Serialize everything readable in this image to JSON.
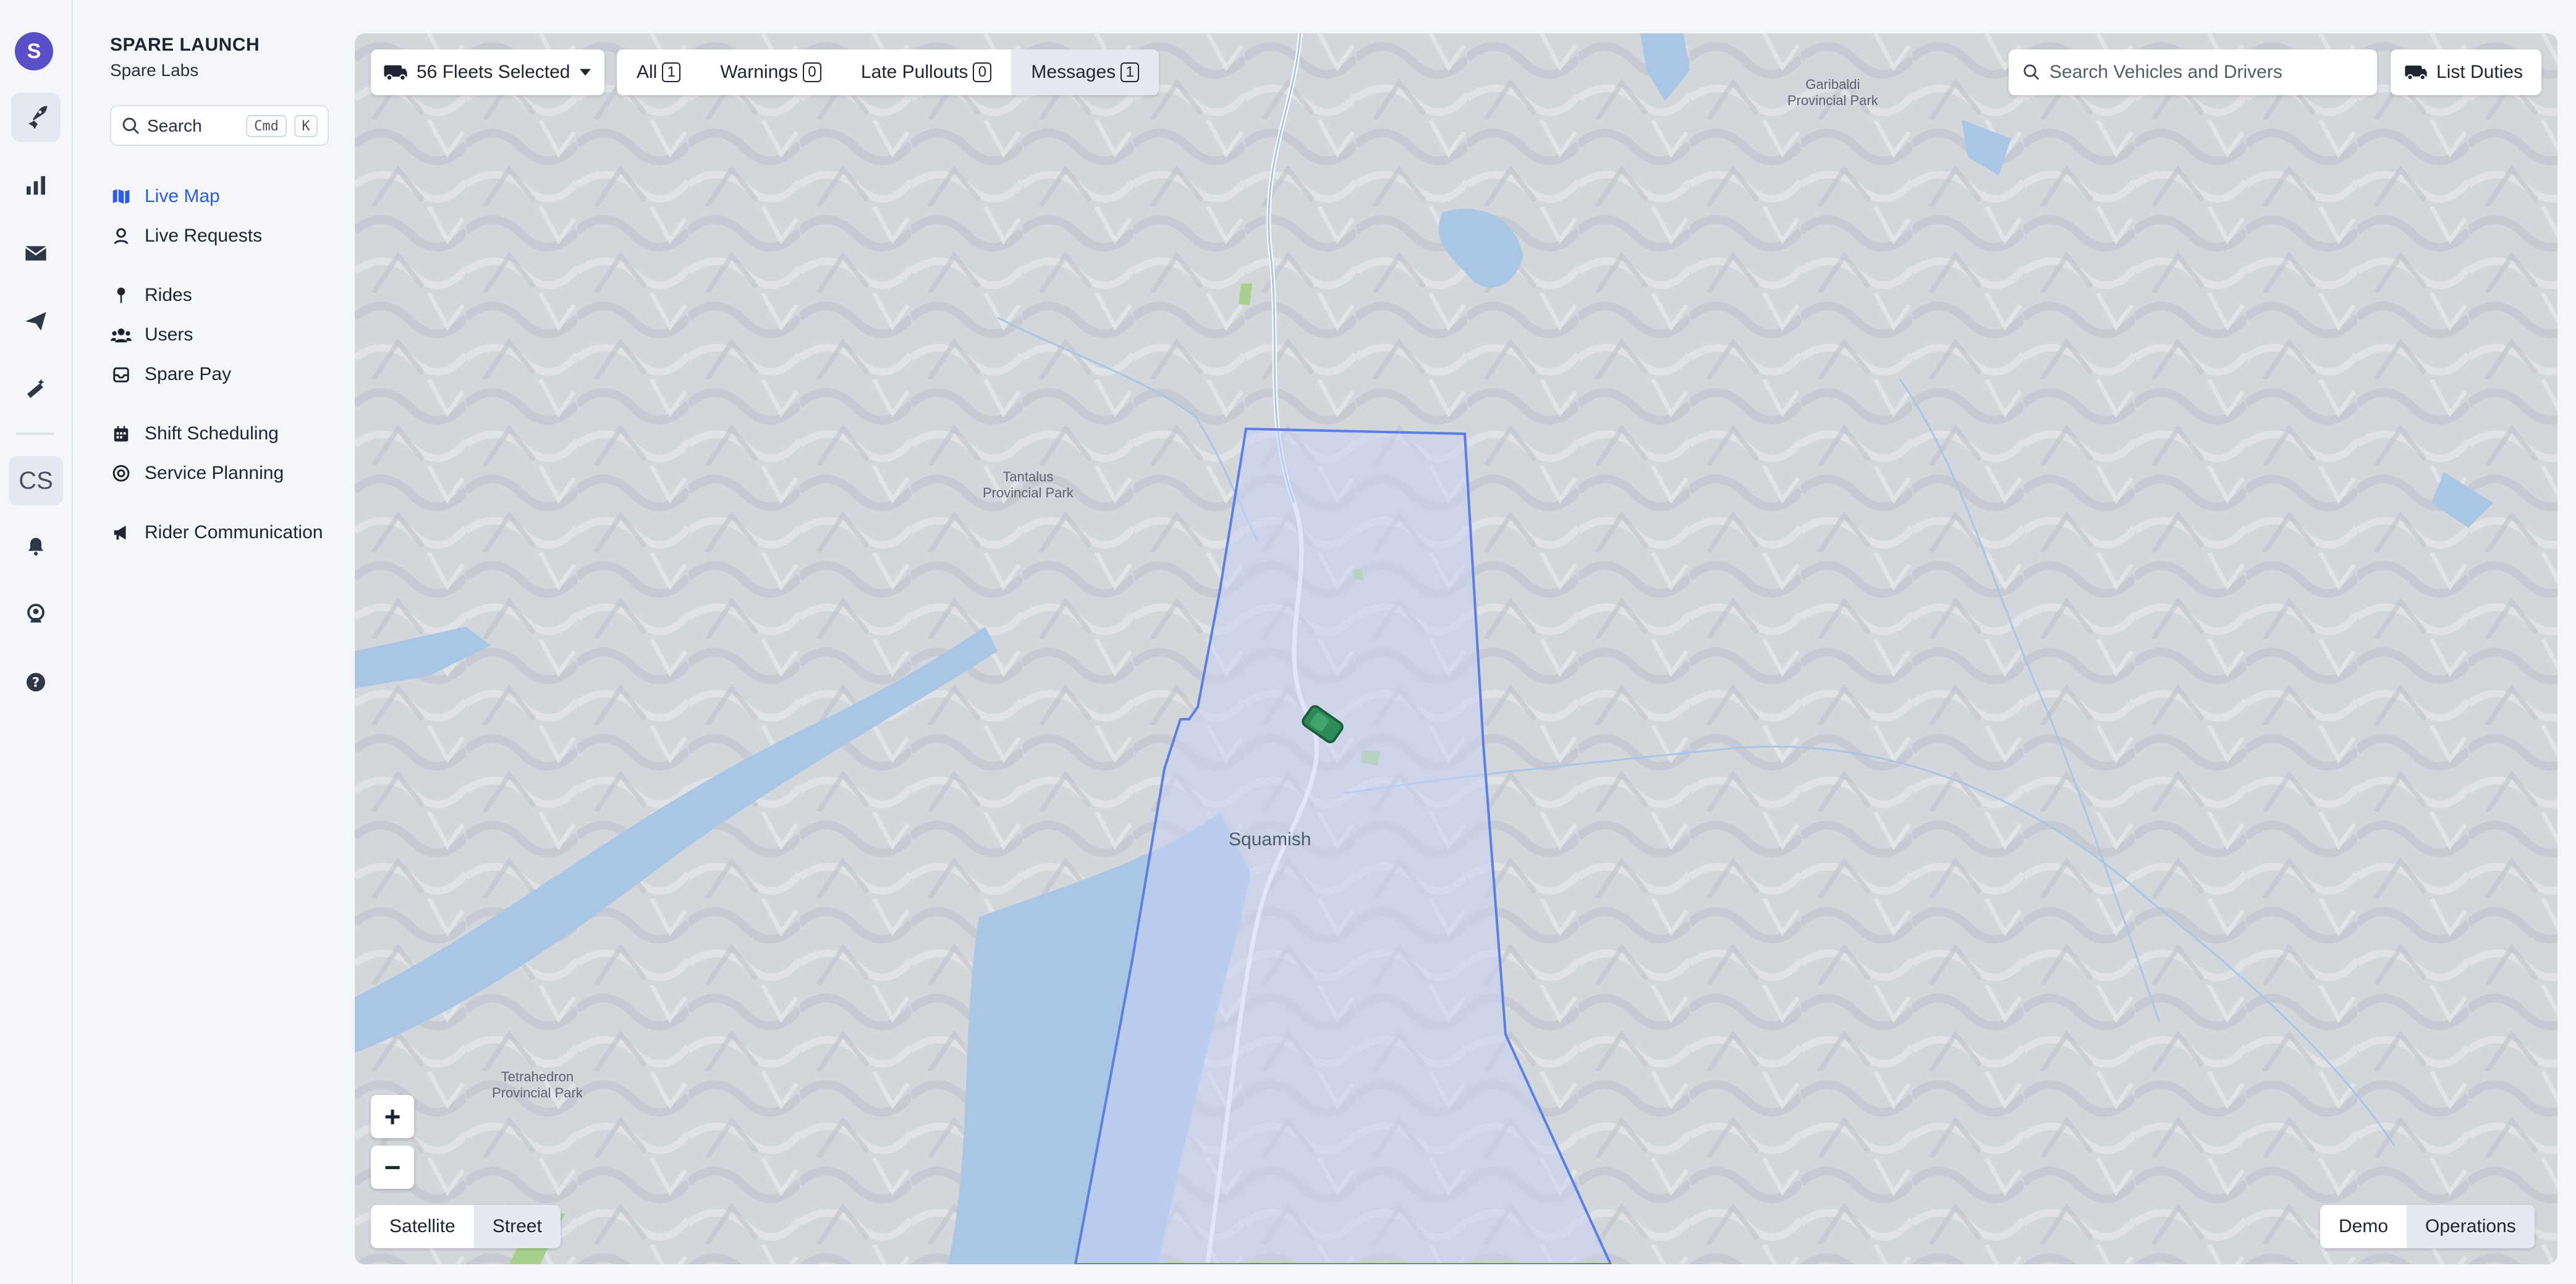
{
  "rail": {
    "logo_letter": "S",
    "cs_label": "CS",
    "icons": [
      "rocket-icon",
      "bar-chart-icon",
      "envelope-icon",
      "paper-plane-icon",
      "magic-wand-icon",
      "bell-icon",
      "user-badge-icon",
      "help-icon"
    ]
  },
  "sidebar": {
    "org_title": "SPARE LAUNCH",
    "org_subtitle": "Spare Labs",
    "search_placeholder": "Search",
    "shortcut_cmd": "Cmd",
    "shortcut_key": "K",
    "items": [
      {
        "label": "Live Map",
        "icon": "map-icon",
        "active": true
      },
      {
        "label": "Live Requests",
        "icon": "person-pin-icon"
      },
      {
        "label": "Rides",
        "icon": "pin-icon"
      },
      {
        "label": "Users",
        "icon": "users-icon"
      },
      {
        "label": "Spare Pay",
        "icon": "wallet-icon"
      },
      {
        "label": "Shift Scheduling",
        "icon": "calendar-icon"
      },
      {
        "label": "Service Planning",
        "icon": "target-icon"
      },
      {
        "label": "Rider Communication",
        "icon": "megaphone-icon"
      }
    ]
  },
  "map": {
    "fleets_label": "56 Fleets Selected",
    "filters": [
      {
        "label": "All",
        "count": "1"
      },
      {
        "label": "Warnings",
        "count": "0"
      },
      {
        "label": "Late Pullouts",
        "count": "0"
      },
      {
        "label": "Messages",
        "count": "1"
      }
    ],
    "vehicle_search_placeholder": "Search Vehicles and Drivers",
    "list_duties_label": "List Duties",
    "zoom_in": "+",
    "zoom_out": "−",
    "layer_options": [
      "Satellite",
      "Street"
    ],
    "mode_options": [
      "Demo",
      "Operations"
    ],
    "places": {
      "town": "Squamish",
      "park_garibaldi": "Garibaldi\nProvincial Park",
      "park_tantalus": "Tantalus\nProvincial Park",
      "park_tetrahedron": "Tetrahedron\nProvincial Park"
    },
    "colors": {
      "zone_outline": "#5b7fe6",
      "zone_fill": "#c9d3f5",
      "water": "#a9c6e6",
      "vehicle": "#2e8b57",
      "accent": "#2d5be3"
    }
  }
}
